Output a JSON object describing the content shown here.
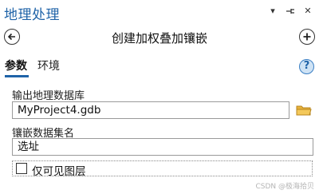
{
  "pane": {
    "title": "地理处理",
    "controls": {
      "menu_glyph": "▾",
      "pin_glyph": "⊣",
      "close_glyph": "✕"
    }
  },
  "tool": {
    "title": "创建加权叠加镶嵌",
    "back_icon": "back-arrow-circle-icon",
    "add_icon": "plus-circle-icon"
  },
  "tabs": [
    {
      "label": "参数",
      "active": true
    },
    {
      "label": "环境",
      "active": false
    }
  ],
  "help": {
    "glyph": "?"
  },
  "fields": {
    "output_gdb": {
      "label": "输出地理数据库",
      "value": "MyProject4.gdb",
      "browse_icon": "folder-icon"
    },
    "mosaic_name": {
      "label": "镶嵌数据集名",
      "value": "选址"
    },
    "visible_only": {
      "label": "仅可见图层",
      "checked": false
    }
  },
  "watermark": "CSDN @极海拾贝",
  "colors": {
    "accent": "#1f63a8",
    "folder": "#e8b33c"
  }
}
